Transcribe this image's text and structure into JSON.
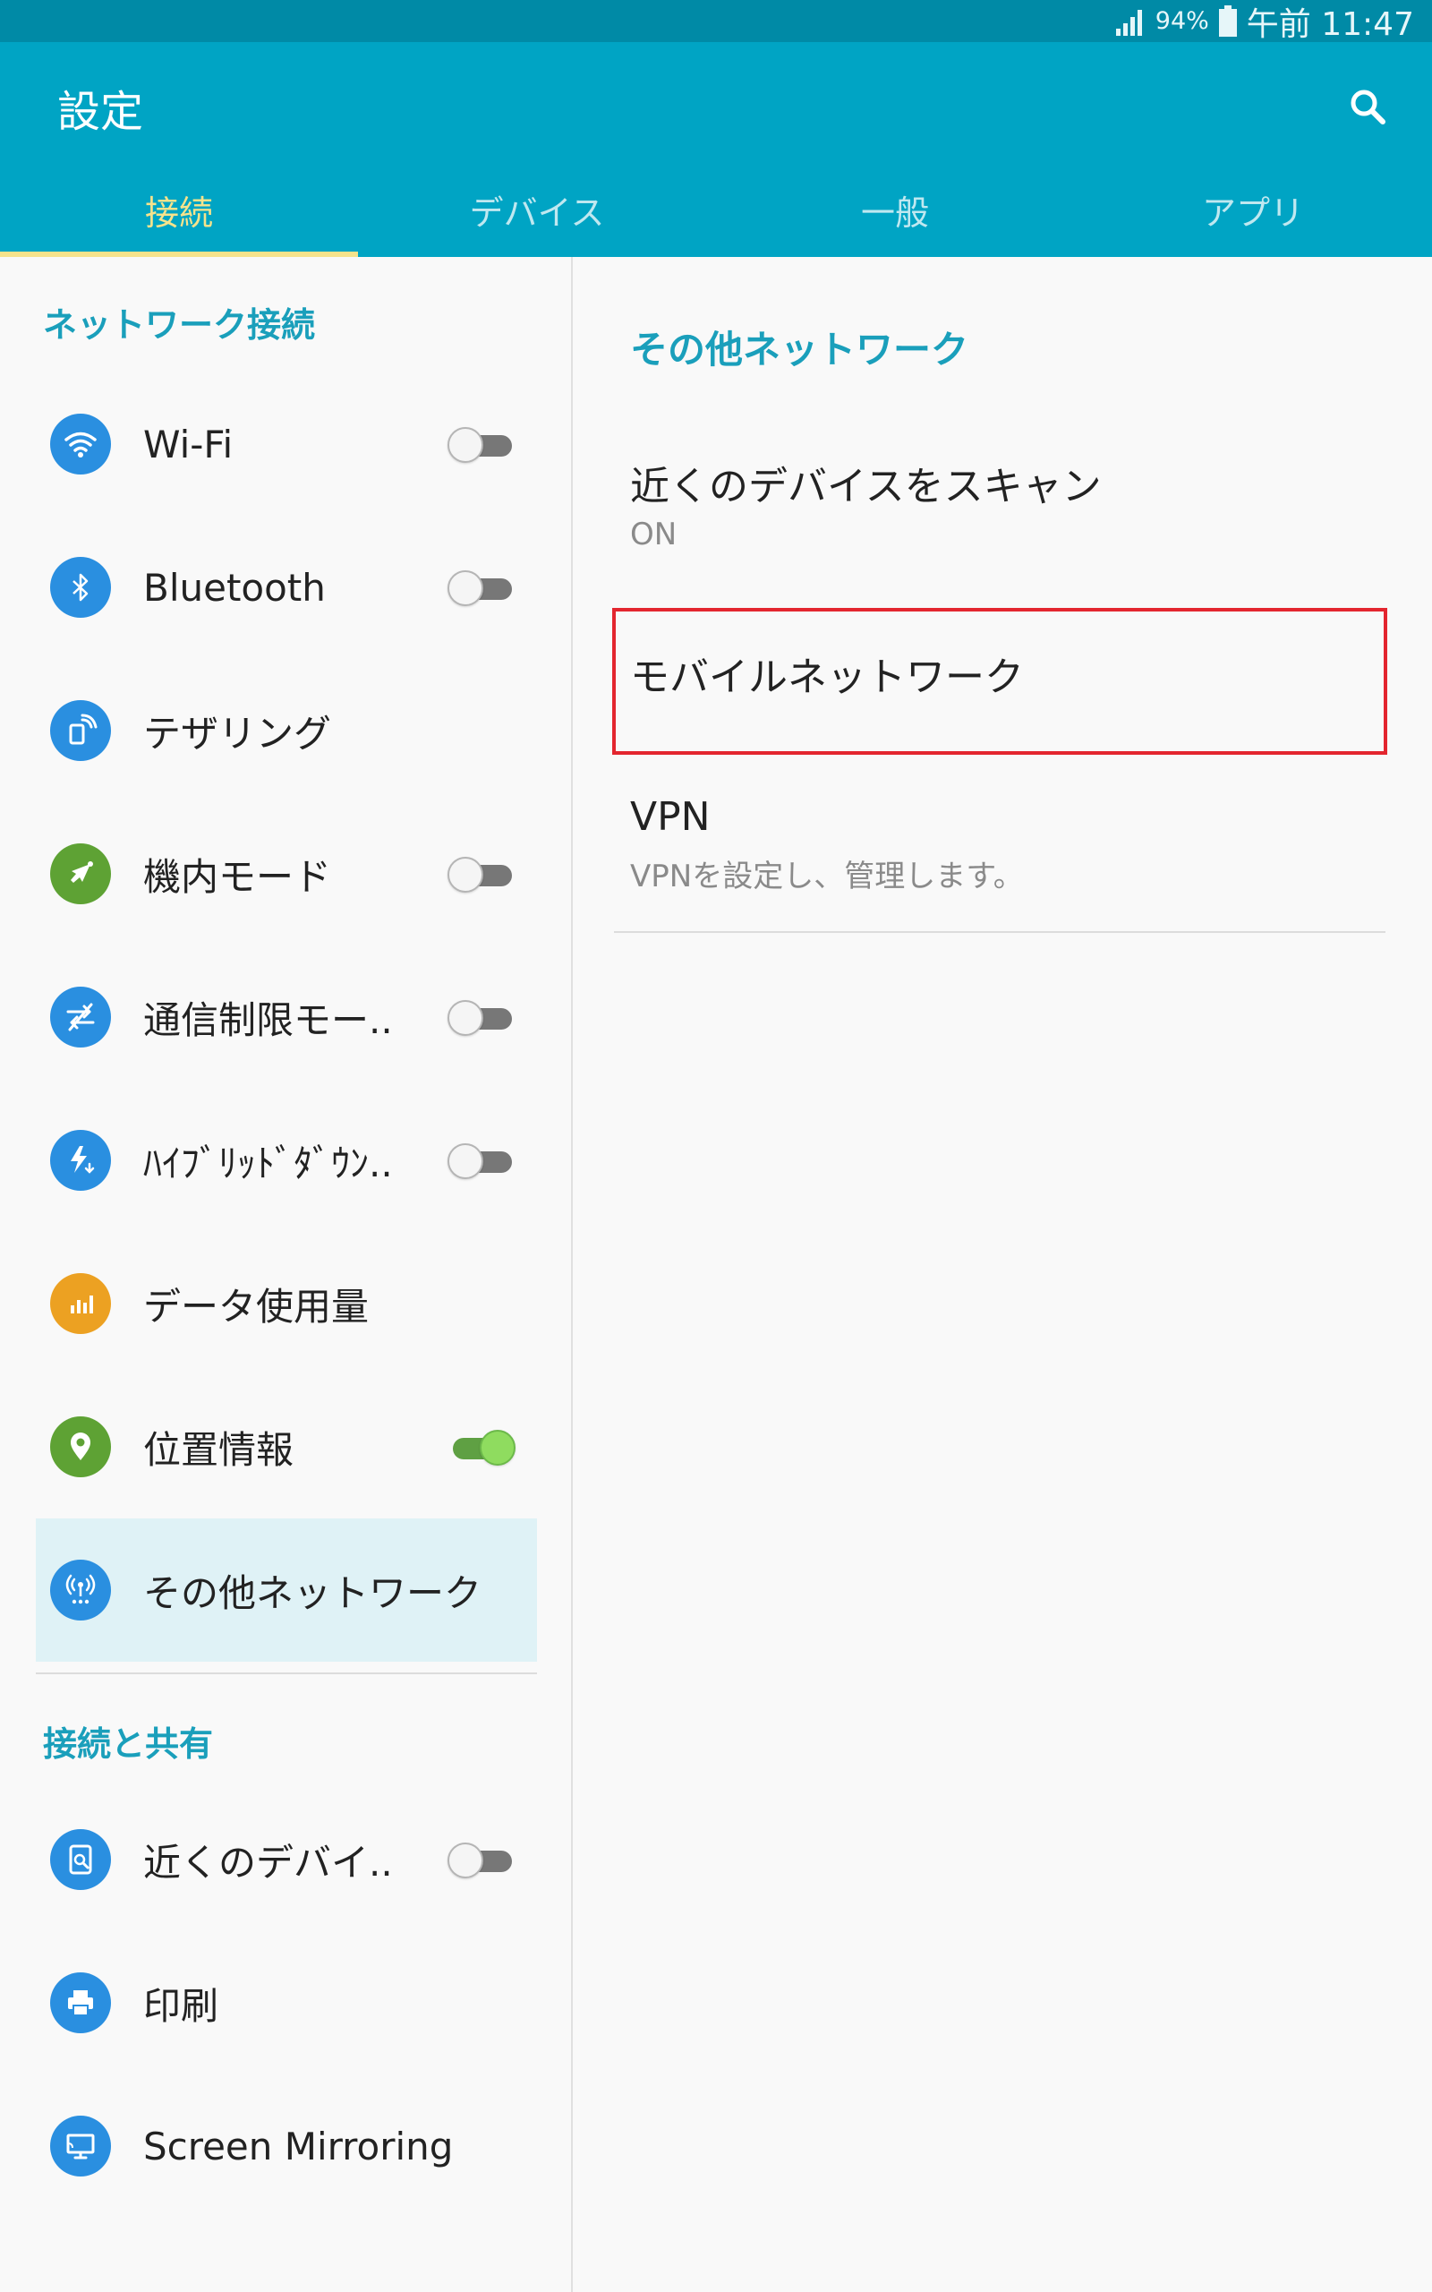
{
  "status": {
    "battery": "94%",
    "time": "午前 11:47"
  },
  "appbar": {
    "title": "設定",
    "search_icon": "search-icon"
  },
  "tabs": [
    {
      "label": "接続",
      "active": true
    },
    {
      "label": "デバイス",
      "active": false
    },
    {
      "label": "一般",
      "active": false
    },
    {
      "label": "アプリ",
      "active": false
    }
  ],
  "left": {
    "section1": "ネットワーク接続",
    "section2": "接続と共有",
    "items": [
      {
        "label": "Wi-Fi",
        "icon": "wifi-icon",
        "color": "#2a8fe0",
        "toggle": "off"
      },
      {
        "label": "Bluetooth",
        "icon": "bluetooth-icon",
        "color": "#2a8fe0",
        "toggle": "off"
      },
      {
        "label": "テザリング",
        "icon": "tethering-icon",
        "color": "#2a8fe0"
      },
      {
        "label": "機内モード",
        "icon": "airplane-icon",
        "color": "#5ea234",
        "toggle": "off"
      },
      {
        "label": "通信制限モー..",
        "icon": "data-restrict-icon",
        "color": "#2a8fe0",
        "toggle": "off"
      },
      {
        "label": "ﾊｲﾌﾞﾘｯﾄﾞﾀﾞｳﾝ..",
        "icon": "hybrid-download-icon",
        "color": "#2a8fe0",
        "toggle": "off"
      },
      {
        "label": "データ使用量",
        "icon": "data-usage-icon",
        "color": "#eca122"
      },
      {
        "label": "位置情報",
        "icon": "location-icon",
        "color": "#5ea234",
        "toggle": "on"
      },
      {
        "label": "その他ネットワーク",
        "icon": "more-networks-icon",
        "color": "#2a8fe0",
        "selected": true
      },
      {
        "label": "近くのデバイ..",
        "icon": "nearby-device-icon",
        "color": "#2a8fe0",
        "toggle": "off"
      },
      {
        "label": "印刷",
        "icon": "print-icon",
        "color": "#2a8fe0"
      },
      {
        "label": "Screen Mirroring",
        "icon": "screen-mirroring-icon",
        "color": "#2a8fe0"
      }
    ]
  },
  "right": {
    "header": "その他ネットワーク",
    "items": [
      {
        "title": "近くのデバイスをスキャン",
        "subtitle": "ON"
      },
      {
        "title": "モバイルネットワーク",
        "subtitle": ""
      },
      {
        "title": "VPN",
        "subtitle": "VPNを設定し、管理します。"
      }
    ]
  },
  "colors": {
    "statusbar": "#008aa6",
    "appbar": "#00a4c4",
    "tab_active": "#f6e38c",
    "accent_text": "#1a9fbb",
    "highlight": "#e3262f"
  }
}
